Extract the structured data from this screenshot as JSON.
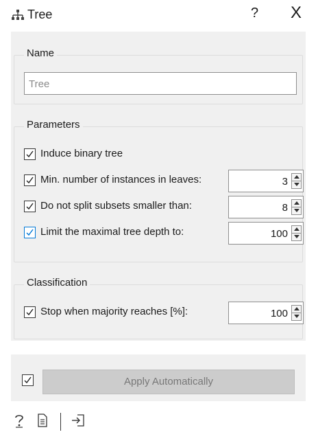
{
  "window": {
    "title": "Tree",
    "icon": "tree-icon",
    "help_label": "?",
    "close_label": "X"
  },
  "name_section": {
    "title": "Name",
    "input_value": "Tree"
  },
  "parameters": {
    "title": "Parameters",
    "items": [
      {
        "label": "Induce binary tree",
        "checked": true
      },
      {
        "label": "Min. number of instances in leaves:",
        "checked": true,
        "value": "3"
      },
      {
        "label": "Do not split subsets smaller than:",
        "checked": true,
        "value": "8"
      },
      {
        "label": "Limit the maximal tree depth to:",
        "checked": true,
        "value": "100",
        "focused": true
      }
    ]
  },
  "classification": {
    "title": "Classification",
    "items": [
      {
        "label": "Stop when majority reaches [%]:",
        "checked": true,
        "value": "100"
      }
    ]
  },
  "apply": {
    "auto_checked": true,
    "button_label": "Apply Automatically"
  },
  "status_bar": {
    "icons": [
      "help-icon",
      "report-icon",
      "input-signal-icon"
    ]
  },
  "colors": {
    "panel_bg": "#f0f0f0",
    "focus_blue": "#0078d7"
  }
}
